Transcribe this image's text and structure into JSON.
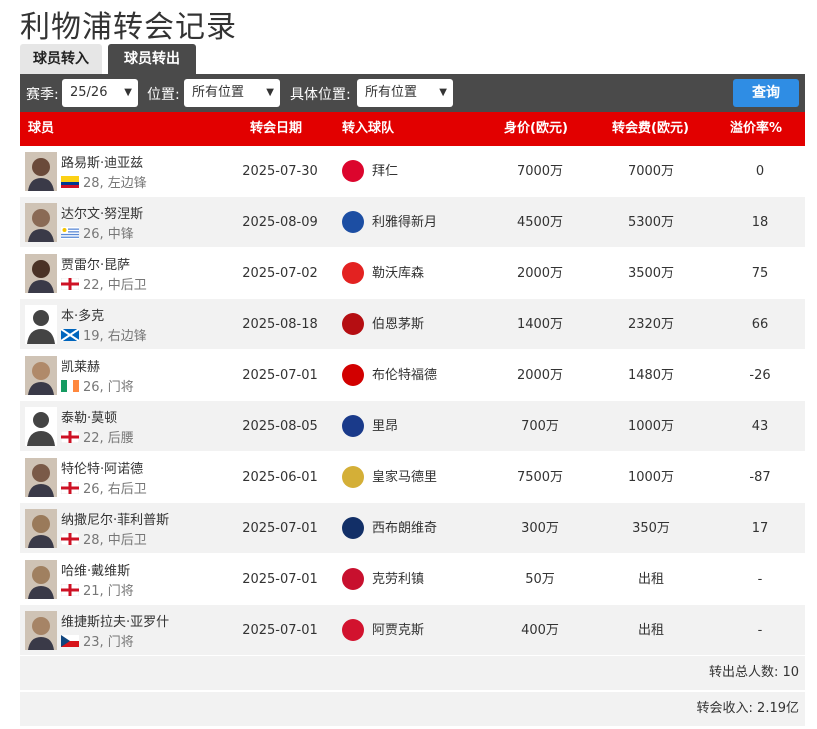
{
  "page": {
    "title": "利物浦转会记录"
  },
  "tabs": [
    {
      "label": "球员转入",
      "active": false
    },
    {
      "label": "球员转出",
      "active": true
    }
  ],
  "filters": {
    "season_label": "赛季:",
    "season_value": "25/26",
    "position_label": "位置:",
    "position_value": "所有位置",
    "detail_position_label": "具体位置:",
    "detail_position_value": "所有位置",
    "query_button": "查询"
  },
  "table": {
    "headers": [
      "球员",
      "转会日期",
      "转入球队",
      "身价(欧元)",
      "转会费(欧元)",
      "溢价率%"
    ],
    "rows": [
      {
        "name": "路易斯·迪亚兹",
        "info": "28, 左边锋",
        "flag": "colombia-flag",
        "date": "2025-07-30",
        "club": "拜仁",
        "club_icon": "bayern-logo",
        "club_color": "#dc052d",
        "value": "7000万",
        "fee": "7000万",
        "premium": "0",
        "avatar_color": "#6a4a3a"
      },
      {
        "name": "达尔文·努涅斯",
        "info": "26, 中锋",
        "flag": "uruguay-flag",
        "date": "2025-08-09",
        "club": "利雅得新月",
        "club_icon": "al-hilal-logo",
        "club_color": "#1c4ea3",
        "value": "4500万",
        "fee": "5300万",
        "premium": "18",
        "avatar_color": "#8a6a55"
      },
      {
        "name": "贾雷尔·昆萨",
        "info": "22, 中后卫",
        "flag": "england-flag",
        "date": "2025-07-02",
        "club": "勒沃库森",
        "club_icon": "leverkusen-logo",
        "club_color": "#e32221",
        "value": "2000万",
        "fee": "3500万",
        "premium": "75",
        "avatar_color": "#4a3226"
      },
      {
        "name": "本·多克",
        "info": "19, 右边锋",
        "flag": "scotland-flag",
        "date": "2025-08-18",
        "club": "伯恩茅斯",
        "club_icon": "bournemouth-logo",
        "club_color": "#b50e12",
        "value": "1400万",
        "fee": "2320万",
        "premium": "66",
        "avatar_color": "#555555"
      },
      {
        "name": "凯莱赫",
        "info": "26, 门将",
        "flag": "ireland-flag",
        "date": "2025-07-01",
        "club": "布伦特福德",
        "club_icon": "brentford-logo",
        "club_color": "#d20000",
        "value": "2000万",
        "fee": "1480万",
        "premium": "-26",
        "avatar_color": "#b08a6a"
      },
      {
        "name": "泰勒·莫顿",
        "info": "22, 后腰",
        "flag": "england-flag",
        "date": "2025-08-05",
        "club": "里昂",
        "club_icon": "lyon-logo",
        "club_color": "#1a3a8a",
        "value": "700万",
        "fee": "1000万",
        "premium": "43",
        "avatar_color": "#555555"
      },
      {
        "name": "特伦特·阿诺德",
        "info": "26, 右后卫",
        "flag": "england-flag",
        "date": "2025-06-01",
        "club": "皇家马德里",
        "club_icon": "real-madrid-logo",
        "club_color": "#d4af37",
        "value": "7500万",
        "fee": "1000万",
        "premium": "-87",
        "avatar_color": "#7a5a48"
      },
      {
        "name": "纳撒尼尔·菲利普斯",
        "info": "28, 中后卫",
        "flag": "england-flag",
        "date": "2025-07-01",
        "club": "西布朗维奇",
        "club_icon": "west-brom-logo",
        "club_color": "#122f67",
        "value": "300万",
        "fee": "350万",
        "premium": "17",
        "avatar_color": "#9a7a5a"
      },
      {
        "name": "哈维·戴维斯",
        "info": "21, 门将",
        "flag": "england-flag",
        "date": "2025-07-01",
        "club": "克劳利镇",
        "club_icon": "crawley-logo",
        "club_color": "#c8102e",
        "value": "50万",
        "fee": "出租",
        "premium": "-",
        "avatar_color": "#a08060"
      },
      {
        "name": "维捷斯拉夫·亚罗什",
        "info": "23, 门将",
        "flag": "czech-flag",
        "date": "2025-07-01",
        "club": "阿贾克斯",
        "club_icon": "ajax-logo",
        "club_color": "#d2122e",
        "value": "400万",
        "fee": "出租",
        "premium": "-",
        "avatar_color": "#a68466"
      }
    ]
  },
  "summary": {
    "total_out": "转出总人数: 10",
    "income": "转会收入: 2.19亿"
  },
  "colors": {
    "header_red": "#e20000",
    "bar_dark": "#4a4a4a",
    "button_blue": "#2f8de4"
  }
}
